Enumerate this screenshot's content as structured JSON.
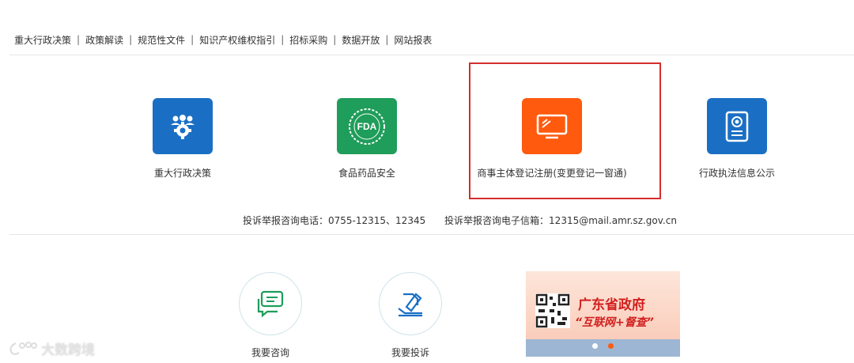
{
  "topnav": {
    "items": [
      "重大行政决策",
      "政策解读",
      "规范性文件",
      "知识产权维权指引",
      "招标采购",
      "数据开放",
      "网站报表"
    ],
    "separator": "|"
  },
  "services": [
    {
      "label": "重大行政决策",
      "icon": "team-gear-icon",
      "color": "#1a6fc4"
    },
    {
      "label": "食品药品安全",
      "icon": "fda-icon",
      "color": "#1f9d5a"
    },
    {
      "label": "商事主体登记注册(变更登记一窗通)",
      "icon": "monitor-icon",
      "color": "#ff5a0d"
    },
    {
      "label": "行政执法信息公示",
      "icon": "id-card-icon",
      "color": "#1a6fc4"
    }
  ],
  "fda_text": "FDA",
  "contact": {
    "phone": "投诉举报咨询电话：0755-12315、12345",
    "email": "投诉举报咨询电子信箱：12315@mail.amr.sz.gov.cn"
  },
  "actions": [
    {
      "label": "我要咨询",
      "icon": "chat-icon"
    },
    {
      "label": "我要投诉",
      "icon": "complaint-icon"
    }
  ],
  "banner": {
    "title": "广东省政府",
    "subtitle": "“互联网+督查”",
    "active_slide": 2,
    "slide_count": 2
  },
  "watermark": "大数跨境",
  "colors": {
    "accent_orange": "#ff5a0d",
    "highlight_border": "#d42d2d",
    "blue": "#1a6fc4",
    "green": "#1f9d5a"
  }
}
